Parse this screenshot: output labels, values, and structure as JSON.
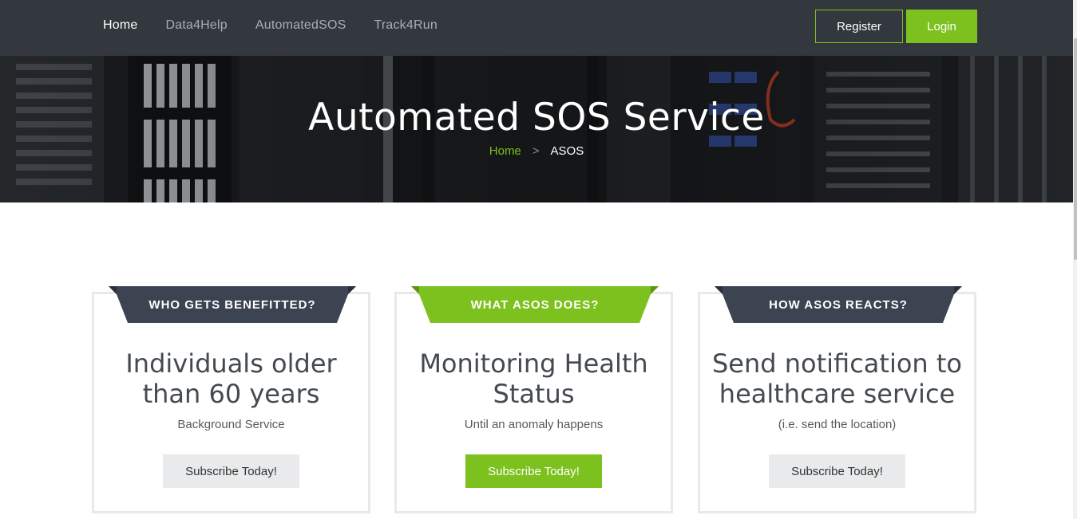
{
  "nav": {
    "links": [
      "Home",
      "Data4Help",
      "AutomatedSOS",
      "Track4Run"
    ],
    "register": "Register",
    "login": "Login"
  },
  "hero": {
    "title": "Automated SOS Service",
    "breadcrumb": {
      "home": "Home",
      "separator": ">",
      "current": "ASOS"
    }
  },
  "cards": [
    {
      "ribbon": "WHO GETS BENEFITTED?",
      "title": "Individuals older than 60 years",
      "subtitle": "Background Service",
      "button": "Subscribe Today!",
      "accent": "#3b4450"
    },
    {
      "ribbon": "WHAT ASOS DOES?",
      "title": "Monitoring Health Status",
      "subtitle": "Until an anomaly happens",
      "button": "Subscribe Today!",
      "accent": "#7dc11f"
    },
    {
      "ribbon": "HOW ASOS REACTS?",
      "title": "Send notification to healthcare service",
      "subtitle": "(i.e. send the location)",
      "button": "Subscribe Today!",
      "accent": "#3b4450"
    }
  ],
  "colors": {
    "brand_green": "#7dc11f",
    "navbar": "#33383f",
    "ribbon_dark": "#3b4450"
  }
}
